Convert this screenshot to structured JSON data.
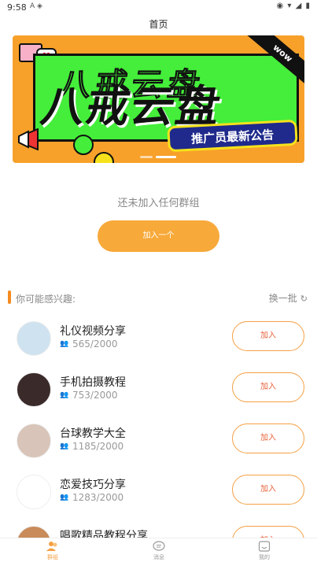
{
  "status_bar": {
    "time": "9:58",
    "left_icons": "A ◈",
    "right_icons": "◉ ▾ ◢ ▮"
  },
  "header": {
    "title": "首页"
  },
  "banner": {
    "main_text": "八戒云盘",
    "sub_text": "推广员最新公告",
    "badge": "wow"
  },
  "empty_state": {
    "text": "还未加入任何群组",
    "button": "加入一个"
  },
  "suggest": {
    "title": "你可能感兴趣:",
    "refresh_label": "换一批",
    "refresh_icon": "refresh-icon",
    "groups": [
      {
        "name": "礼仪视频分享",
        "count": "565/2000",
        "join": "加入",
        "avatar_color": "#cfe2ef"
      },
      {
        "name": "手机拍摄教程",
        "count": "753/2000",
        "join": "加入",
        "avatar_color": "#3a2a2a"
      },
      {
        "name": "台球教学大全",
        "count": "1185/2000",
        "join": "加入",
        "avatar_color": "#d8c4b8"
      },
      {
        "name": "恋爱技巧分享",
        "count": "1283/2000",
        "join": "加入",
        "avatar_color": "#ffffff"
      },
      {
        "name": "唱歌精品教程分享",
        "count": "",
        "join": "加入",
        "avatar_color": "#c98b5a"
      }
    ]
  },
  "tabs": [
    {
      "label": "群组",
      "icon": "group-icon",
      "active": true
    },
    {
      "label": "消息",
      "icon": "message-icon",
      "active": false
    },
    {
      "label": "我的",
      "icon": "profile-icon",
      "active": false
    }
  ],
  "colors": {
    "accent": "#f7a93a",
    "join_text": "#e8623a",
    "banner_bg": "#f7a12a",
    "banner_green": "#44ee3a"
  }
}
